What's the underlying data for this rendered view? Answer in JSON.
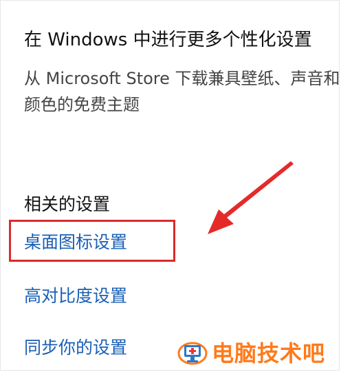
{
  "store_section": {
    "title": "在 Windows 中进行更多个性化设置",
    "description": "从 Microsoft Store 下载兼具壁纸、声音和颜色的免费主题"
  },
  "related_settings": {
    "title": "相关的设置",
    "links": [
      "桌面图标设置",
      "高对比度设置",
      "同步你的设置"
    ]
  },
  "annotation": {
    "highlight_color": "#d92b2b",
    "arrow_color": "#e52a2a"
  },
  "watermark": {
    "text": "电脑技术吧",
    "color": "#ff7a1a"
  },
  "colors": {
    "link": "#1a5fb4",
    "text": "#111111",
    "secondary_text": "#444444"
  }
}
